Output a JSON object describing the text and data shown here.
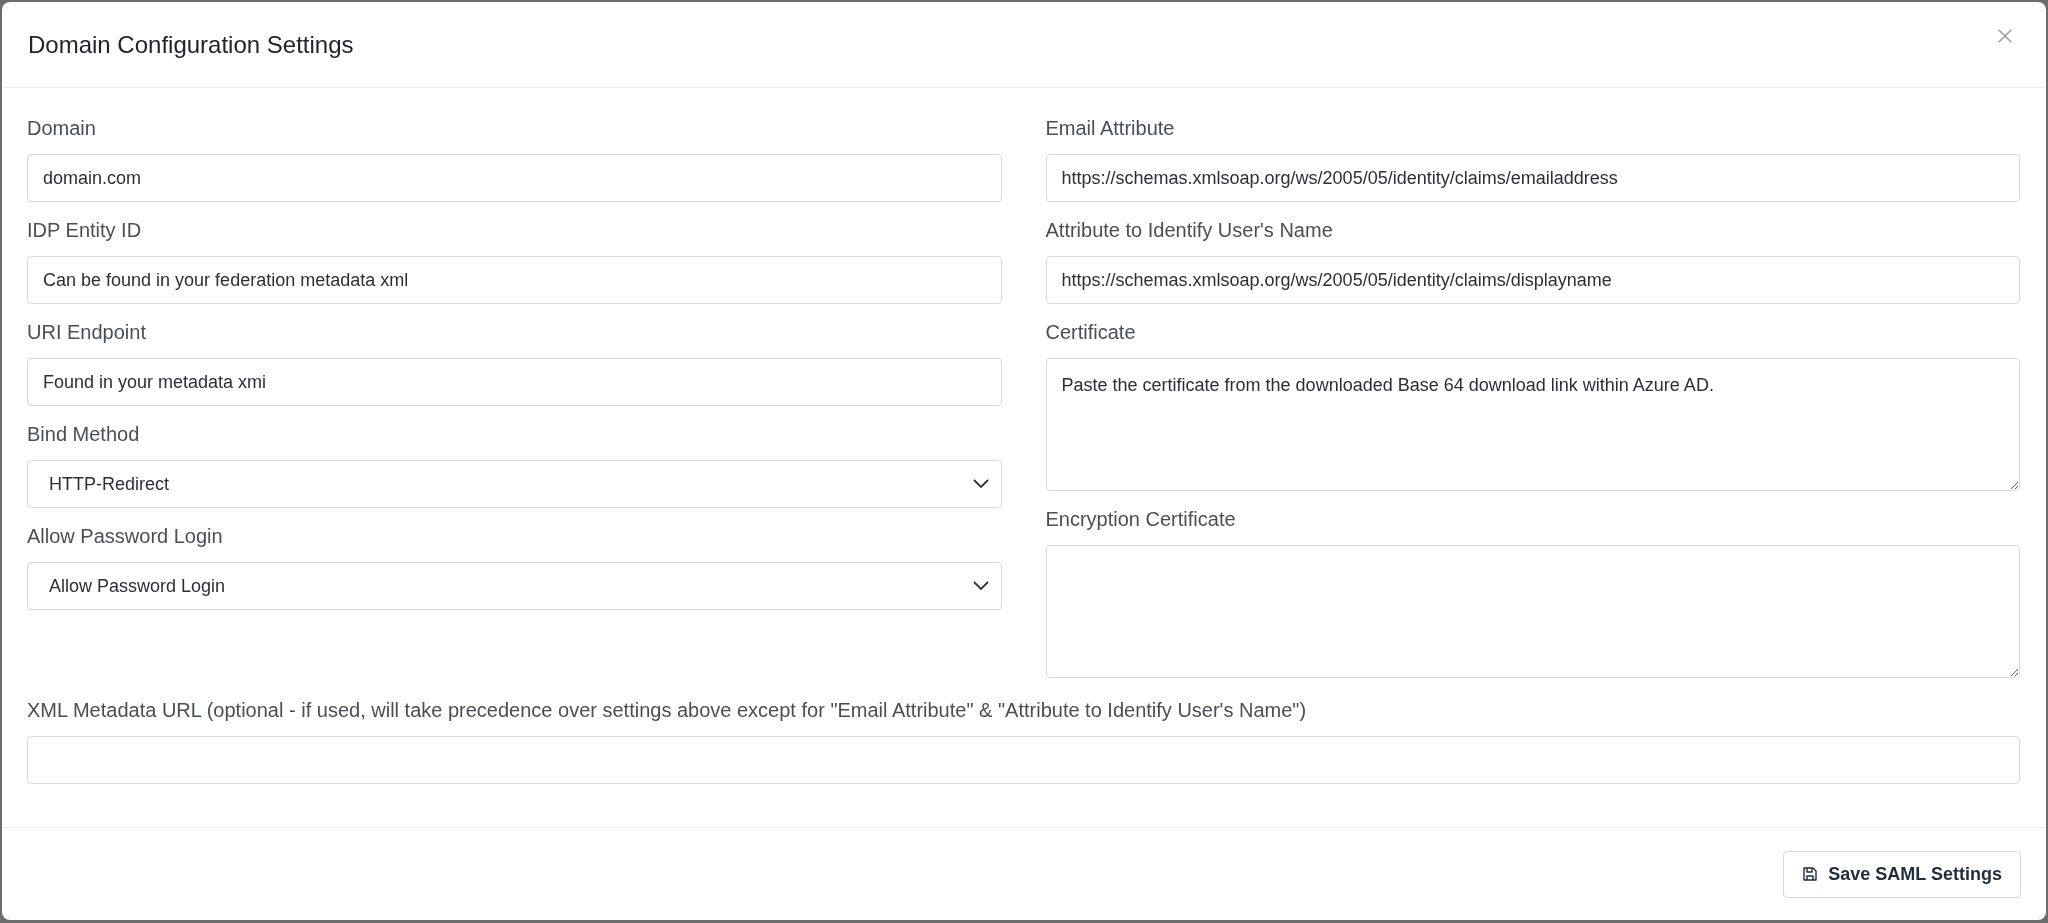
{
  "dialog": {
    "title": "Domain Configuration Settings",
    "left_fields": [
      {
        "kind": "input",
        "label": "Domain",
        "value": "domain.com"
      },
      {
        "kind": "input",
        "label": "IDP Entity ID",
        "value": "Can be found in your federation metadata xml"
      },
      {
        "kind": "input",
        "label": "URI Endpoint",
        "value": "Found in your metadata xmi"
      },
      {
        "kind": "select",
        "label": "Bind Method",
        "value": "HTTP-Redirect"
      },
      {
        "kind": "select",
        "label": "Allow Password Login",
        "value": "Allow Password Login"
      }
    ],
    "right_fields": [
      {
        "kind": "input",
        "label": "Email Attribute",
        "value": "https://schemas.xmlsoap.org/ws/2005/05/identity/claims/emailaddress"
      },
      {
        "kind": "input",
        "label": "Attribute to Identify User's Name",
        "value": "https://schemas.xmlsoap.org/ws/2005/05/identity/claims/displayname"
      },
      {
        "kind": "textarea",
        "label": "Certificate",
        "value": "Paste the certificate from the downloaded Base 64 download link within Azure AD."
      },
      {
        "kind": "textarea",
        "label": "Encryption Certificate"
      }
    ],
    "full_fields": [
      {
        "kind": "input",
        "label": "XML Metadata URL (optional - if used, will take precedence over settings above except for \"Email Attribute\" & \"Attribute to Identify User's Name\")"
      }
    ],
    "save_button": "Save SAML Settings"
  }
}
